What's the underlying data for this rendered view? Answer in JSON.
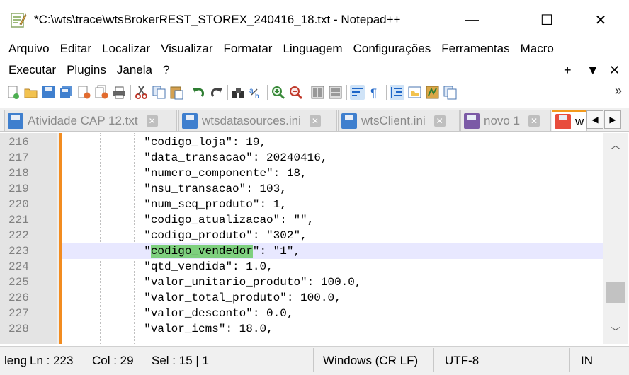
{
  "window": {
    "title": "*C:\\wts\\trace\\wtsBrokerREST_STOREX_240416_18.txt - Notepad++",
    "minimize": "—",
    "maximize": "☐",
    "close": "✕"
  },
  "menu": {
    "row1": [
      "Arquivo",
      "Editar",
      "Localizar",
      "Visualizar",
      "Formatar",
      "Linguagem",
      "Configurações",
      "Ferramentas",
      "Macro"
    ],
    "row2": [
      "Executar",
      "Plugins",
      "Janela",
      "?"
    ],
    "right": {
      "add": "+",
      "dropdown": "▼",
      "close": "✕"
    }
  },
  "toolbar": {
    "icons": [
      "new-file-icon",
      "open-file-icon",
      "save-icon",
      "save-all-icon",
      "close-icon",
      "close-all-icon",
      "print-icon",
      "cut-icon",
      "copy-icon",
      "paste-icon",
      "undo-icon",
      "redo-icon",
      "find-icon",
      "replace-icon",
      "zoom-in-icon",
      "zoom-out-icon",
      "sync-vertical-icon",
      "sync-horizontal-icon",
      "word-wrap-icon",
      "show-all-chars-icon",
      "indent-guide-icon",
      "folder-workspace-icon",
      "document-map-icon",
      "function-list-icon"
    ],
    "more": "»"
  },
  "tabs": [
    {
      "label": "Atividade CAP 12.txt",
      "active": false
    },
    {
      "label": "wtsdatasources.ini",
      "active": false
    },
    {
      "label": "wtsClient.ini",
      "active": false
    },
    {
      "label": "novo 1",
      "active": false
    },
    {
      "label": "w",
      "active": true
    }
  ],
  "tab_nav": {
    "prev": "◀",
    "next": "▶"
  },
  "editor": {
    "lines": [
      {
        "num": "216",
        "pre": "            \"codigo_loja\": 19,",
        "hl": "",
        "post": ""
      },
      {
        "num": "217",
        "pre": "            \"data_transacao\": 20240416,",
        "hl": "",
        "post": ""
      },
      {
        "num": "218",
        "pre": "            \"numero_componente\": 18,",
        "hl": "",
        "post": ""
      },
      {
        "num": "219",
        "pre": "            \"nsu_transacao\": 103,",
        "hl": "",
        "post": ""
      },
      {
        "num": "220",
        "pre": "            \"num_seq_produto\": 1,",
        "hl": "",
        "post": ""
      },
      {
        "num": "221",
        "pre": "            \"codigo_atualizacao\": \"\",",
        "hl": "",
        "post": ""
      },
      {
        "num": "222",
        "pre": "            \"codigo_produto\": \"302\",",
        "hl": "",
        "post": ""
      },
      {
        "num": "223",
        "pre": "            \"",
        "hl": "codigo_vendedor",
        "post": "\": \"1\","
      },
      {
        "num": "224",
        "pre": "            \"qtd_vendida\": 1.0,",
        "hl": "",
        "post": ""
      },
      {
        "num": "225",
        "pre": "            \"valor_unitario_produto\": 100.0,",
        "hl": "",
        "post": ""
      },
      {
        "num": "226",
        "pre": "            \"valor_total_produto\": 100.0,",
        "hl": "",
        "post": ""
      },
      {
        "num": "227",
        "pre": "            \"valor_desconto\": 0.0,",
        "hl": "",
        "post": ""
      },
      {
        "num": "228",
        "pre": "            \"valor_icms\": 18.0,",
        "hl": "",
        "post": ""
      }
    ],
    "current_line": "223"
  },
  "scrollbar": {
    "up": "︿",
    "down": "﹀"
  },
  "status": {
    "length": "leng",
    "ln": "Ln : 223",
    "col": "Col : 29",
    "sel": "Sel : 15 | 1",
    "eol": "Windows (CR LF)",
    "encoding": "UTF-8",
    "mode": "IN"
  },
  "colors": {
    "tab_active_accent": "#f39a1c",
    "change_bar": "#f28c20",
    "current_line": "#e8e8ff",
    "selection_highlight": "#7ed07e"
  }
}
